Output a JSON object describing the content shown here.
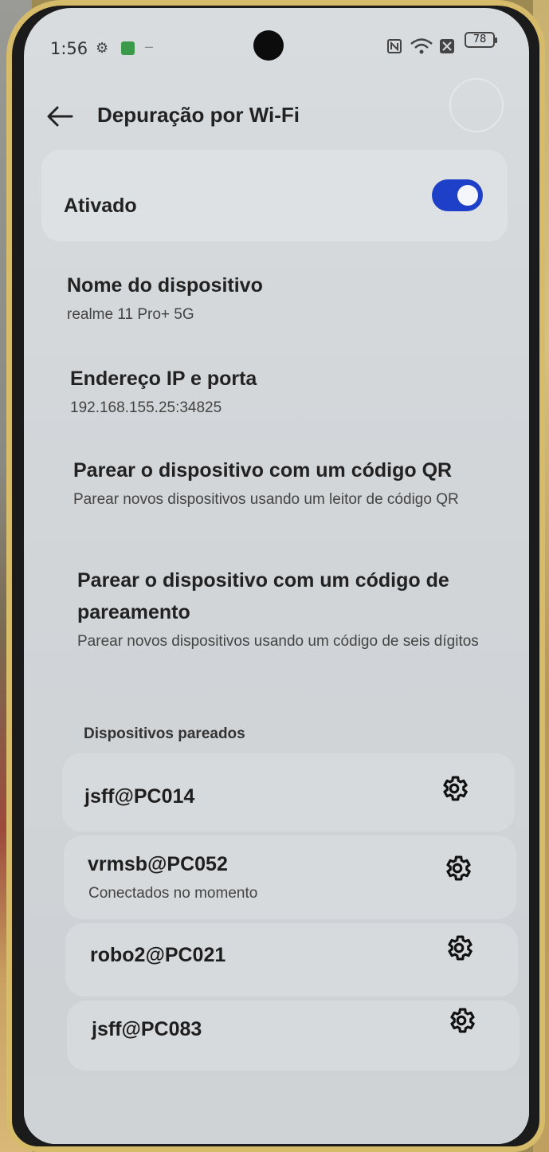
{
  "status_bar": {
    "time": "1:56",
    "battery": "78"
  },
  "app_bar": {
    "title": "Depuração por Wi-Fi"
  },
  "toggle_card": {
    "label": "Ativado",
    "enabled": true
  },
  "settings": [
    {
      "title": "Nome do dispositivo",
      "subtitle": "realme 11 Pro+ 5G"
    },
    {
      "title": "Endereço IP e porta",
      "subtitle": "192.168.155.25:34825"
    },
    {
      "title": "Parear o dispositivo com um código QR",
      "subtitle": "Parear novos dispositivos usando um leitor de código QR"
    },
    {
      "title": "Parear o dispositivo com um código de pareamento",
      "subtitle": "Parear novos dispositivos usando um código de seis dígitos"
    }
  ],
  "paired_section": {
    "header": "Dispositivos pareados",
    "devices": [
      {
        "name": "jsff@PC014",
        "status": ""
      },
      {
        "name": "vrmsb@PC052",
        "status": "Conectados no momento"
      },
      {
        "name": "robo2@PC021",
        "status": ""
      },
      {
        "name": "jsff@PC083",
        "status": ""
      }
    ]
  },
  "colors": {
    "accent": "#1e3fc8",
    "background": "#d6dadc"
  }
}
